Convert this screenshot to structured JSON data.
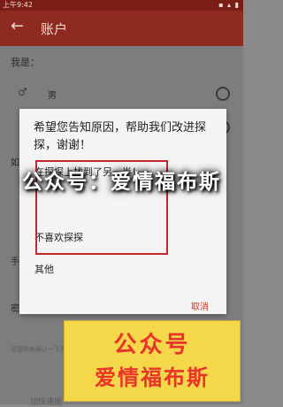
{
  "status_bar": {
    "time": "上午9:42"
  },
  "app_bar": {
    "back_icon": "←",
    "title": "账户"
  },
  "content": {
    "i_am_label": "我是：",
    "male_icon": "♂",
    "male_label": "男",
    "cut_letters": [
      "如",
      "手",
      "密"
    ],
    "bottom_faded": "清楚你来确认一下内容",
    "bottom_link": "加快速度"
  },
  "dialog": {
    "title": "希望您告知原因，帮助我们改进探探，谢谢！",
    "options": [
      "在探探上找到了另一半！",
      "不喜欢探探",
      "其他"
    ],
    "cancel": "取消"
  },
  "watermark": {
    "text": "公众号：爱情福布斯"
  },
  "banner": {
    "line1": "公众号",
    "line2": "爱情福布斯"
  },
  "colors": {
    "accent": "#8e2a1f",
    "highlight_box": "#c0282a",
    "banner_bg": "#f5d84a",
    "banner_text": "#e8352c"
  }
}
